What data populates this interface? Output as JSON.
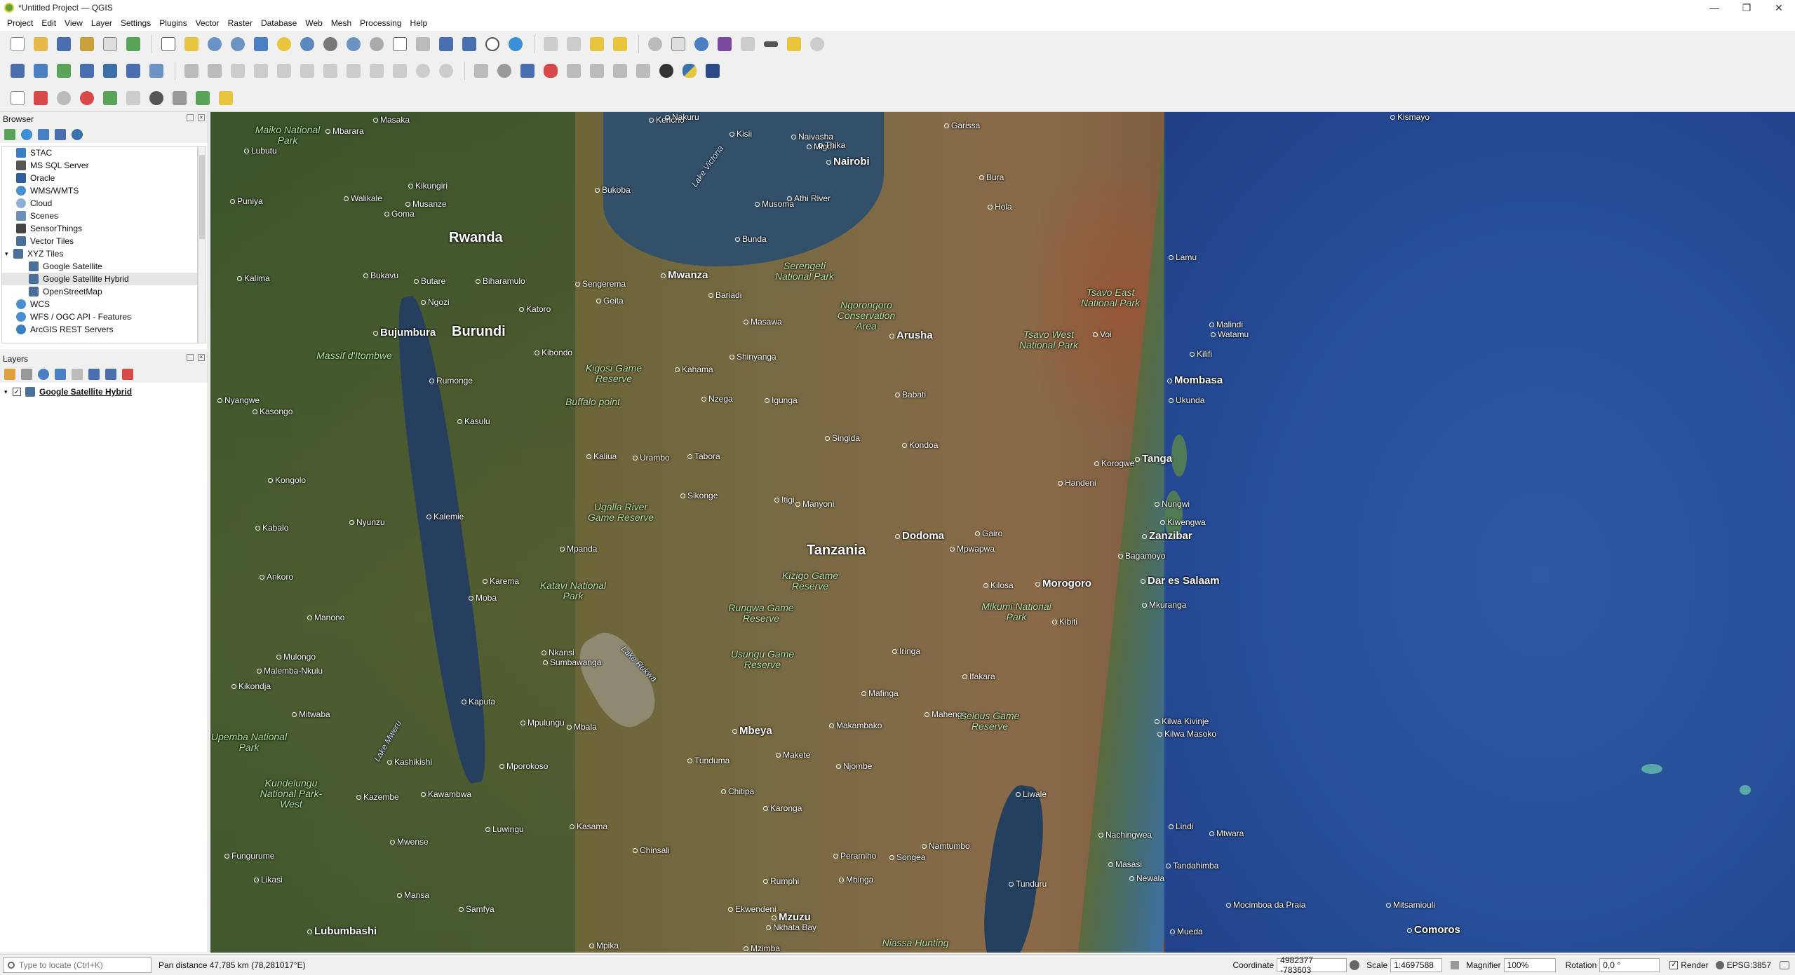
{
  "window": {
    "title": "*Untitled Project — QGIS",
    "controls": [
      "—",
      "❐",
      "✕"
    ]
  },
  "menu": [
    "Project",
    "Edit",
    "View",
    "Layer",
    "Settings",
    "Plugins",
    "Vector",
    "Raster",
    "Database",
    "Web",
    "Mesh",
    "Processing",
    "Help"
  ],
  "browser": {
    "title": "Browser",
    "items": [
      {
        "label": "STAC",
        "color": "#3a7fc4"
      },
      {
        "label": "MS SQL Server",
        "color": "#555"
      },
      {
        "label": "Oracle",
        "color": "#2f5f9e"
      },
      {
        "label": "WMS/WMTS",
        "color": "#4a8fd0"
      },
      {
        "label": "Cloud",
        "color": "#8cb0d8"
      },
      {
        "label": "Scenes",
        "color": "#6a8fb8"
      },
      {
        "label": "SensorThings",
        "color": "#444"
      },
      {
        "label": "Vector Tiles",
        "color": "#4a6f9b"
      },
      {
        "label": "XYZ Tiles",
        "color": "#4a6f9b"
      },
      {
        "label": "Google Satellite",
        "color": "#4a6f9b"
      },
      {
        "label": "Google Satellite Hybrid",
        "color": "#4a6f9b"
      },
      {
        "label": "OpenStreetMap",
        "color": "#4a6f9b"
      },
      {
        "label": "WCS",
        "color": "#4a8fd0"
      },
      {
        "label": "WFS / OGC API - Features",
        "color": "#4a8fd0"
      },
      {
        "label": "ArcGIS REST Servers",
        "color": "#3a7fc4"
      }
    ]
  },
  "layers": {
    "title": "Layers",
    "items": [
      {
        "label": "Google Satellite Hybrid",
        "checked": true
      }
    ]
  },
  "map": {
    "countries": [
      "Rwanda",
      "Burundi",
      "Tanzania"
    ],
    "cities": [
      "Masaka",
      "Kericho",
      "Nakuru",
      "Mbarara",
      "Kisii",
      "Naivasha",
      "Garissa",
      "Kismayo",
      "Lubutu",
      "Migori",
      "Thika",
      "Nairobi",
      "Bura",
      "Kikungiri",
      "Bukoba",
      "Musoma",
      "Athi River",
      "Hola",
      "Puniya",
      "Walikale",
      "Goma",
      "Musanze",
      "Bunda",
      "Kalima",
      "Bukavu",
      "Butare",
      "Biharamulo",
      "Sengerema",
      "Mwanza",
      "Bariadi",
      "Lamu",
      "Katoro",
      "Geita",
      "Ngozi",
      "Arusha",
      "Masawa",
      "Voi",
      "Malindi",
      "Watamu",
      "Kilifi",
      "Mombasa",
      "Ukunda",
      "Bujumbura",
      "Kibondo",
      "Shinyanga",
      "Kahama",
      "Rumonge",
      "Babati",
      "Nzega",
      "Igunga",
      "Kasulu",
      "Kaliua",
      "Urambo",
      "Tabora",
      "Singida",
      "Kondoa",
      "Korogwe",
      "Tanga",
      "Handeni",
      "Nyangwe",
      "Kasongo",
      "Sikonge",
      "Itigi",
      "Manyoni",
      "Kongolo",
      "Nyunzu",
      "Kalemie",
      "Dodoma",
      "Mpwapwa",
      "Gairo",
      "Nungwi",
      "Kiwengwa",
      "Zanzibar",
      "Bagamoyo",
      "Kabalo",
      "Mpanda",
      "Kilosa",
      "Morogoro",
      "Dar es Salaam",
      "Mkuranga",
      "Ankoro",
      "Karema",
      "Moba",
      "Manono",
      "Mulongo",
      "Malemba-Nkulu",
      "Kikondja",
      "Nkansi",
      "Sumbawanga",
      "Iringa",
      "Ifakara",
      "Kaputa",
      "Mitwaba",
      "Mpulungu",
      "Mbala",
      "Mbeya",
      "Makambako",
      "Mahenge",
      "Kilwa Kivinje",
      "Kilwa Masoko",
      "Mafinga",
      "Kashikishi",
      "Mporokoso",
      "Tunduma",
      "Makete",
      "Njombe",
      "Kazembe",
      "Kawambwa",
      "Chitipa",
      "Karonga",
      "Liwale",
      "Lindi",
      "Luwingu",
      "Kasama",
      "Mtwara",
      "Nachingwea",
      "Mwense",
      "Chinsali",
      "Namtumbo",
      "Masasi",
      "Tandahimba",
      "Peramiho",
      "Songea",
      "Newala",
      "Fungurume",
      "Likasi",
      "Rumphi",
      "Mbinga",
      "Tunduru",
      "Mansa",
      "Samfya",
      "Ekwendeni",
      "Mzuzu",
      "Nkhata Bay",
      "Mocimboa da Praia",
      "Mueda",
      "Lubumbashi",
      "Mpika",
      "Mzimba",
      "Mitsamiouli",
      "Comoros",
      "Kibiti"
    ],
    "major_cities": [
      "Nairobi",
      "Mwanza",
      "Arusha",
      "Mombasa",
      "Dodoma",
      "Morogoro",
      "Dar es Salaam",
      "Zanzibar",
      "Mbeya",
      "Mzuzu",
      "Lubumbashi",
      "Comoros",
      "Bujumbura",
      "Tanga"
    ],
    "parks": [
      "Maiko National Park",
      "Serengeti National Park",
      "Ngorongoro Conservation Area",
      "Tsavo East National Park",
      "Tsavo West National Park",
      "Kigosi Game Reserve",
      "Buffalo point",
      "Massif d'Itombwe",
      "Ugalla River Game Reserve",
      "Katavi National Park",
      "Kizigo Game Reserve",
      "Rungwa Game Reserve",
      "Mikumi National Park",
      "Usungu Game Reserve",
      "Selous Game Reserve",
      "Upemba National Park",
      "Kundelungu National Park-West",
      "Niassa Hunting"
    ],
    "lakes": [
      "Lake Victoria",
      "Lake Rukwa",
      "Lake Mweru"
    ]
  },
  "status": {
    "locate_placeholder": "Type to locate (Ctrl+K)",
    "pan_distance": "Pan distance 47,785 km (78,281017°E)",
    "coordinate_label": "Coordinate",
    "coordinate_value": "4982377 -783603",
    "scale_label": "Scale",
    "scale_value": "1:4697588",
    "magnifier_label": "Magnifier",
    "magnifier_value": "100%",
    "rotation_label": "Rotation",
    "rotation_value": "0,0 °",
    "render_label": "Render",
    "crs": "EPSG:3857"
  }
}
